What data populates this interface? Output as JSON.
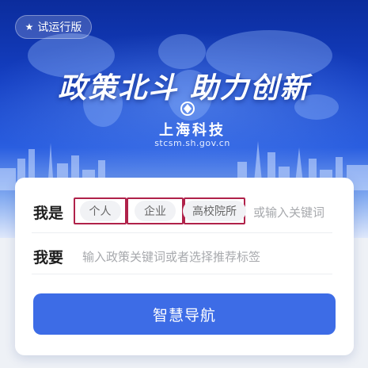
{
  "badge": {
    "icon": "star-icon",
    "label": "试运行版"
  },
  "hero": {
    "slogan": "政策北斗  助力创新",
    "org_name": "上海科技",
    "org_url": "stcsm.sh.gov.cn"
  },
  "form": {
    "identity": {
      "label": "我是",
      "options": [
        "个人",
        "企业",
        "高校院所"
      ],
      "placeholder": "或输入关键词"
    },
    "need": {
      "label": "我要",
      "placeholder": "输入政策关键词或者选择推荐标签"
    },
    "submit_label": "智慧导航"
  },
  "colors": {
    "hero_blue": "#1540c4",
    "button_blue": "#3d6ce6",
    "highlight_border": "#b0224a"
  }
}
